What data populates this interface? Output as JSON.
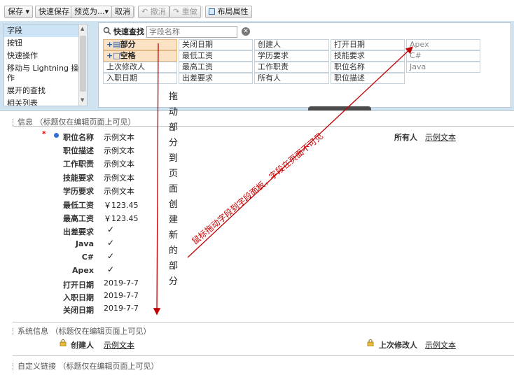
{
  "toolbar": {
    "save": "保存 ▾",
    "quick_save": "快速保存",
    "preview": "预览为...▾",
    "cancel": "取消",
    "undo": "撤消",
    "redo": "重做",
    "layout_props": "布局属性"
  },
  "categories": [
    "字段",
    "按钮",
    "快速操作",
    "移动与 Lightning 操作",
    "展开的查找",
    "相关列表"
  ],
  "quick_find": {
    "label": "快速查找",
    "placeholder": "字段名称"
  },
  "palette_fields": [
    [
      "部分",
      "关闭日期",
      "创建人",
      "打开日期",
      "Apex"
    ],
    [
      "空格",
      "最低工资",
      "学历要求",
      "技能要求",
      "C#"
    ],
    [
      "上次修改人",
      "最高工资",
      "工作职责",
      "职位名称",
      "Java"
    ],
    [
      "入职日期",
      "出差要求",
      "所有人",
      "职位描述",
      ""
    ]
  ],
  "annotations": {
    "vertical": "拖动部分到页面创建新的部分",
    "diagonal": "鼠标拖动字段到字段面板，字段在页面不可见"
  },
  "section_info": {
    "title": "信息 （标题仅在编辑页面上可见）",
    "fields": [
      {
        "label": "职位名称",
        "value": "示例文本",
        "type": "text"
      },
      {
        "label": "职位描述",
        "value": "示例文本",
        "type": "text"
      },
      {
        "label": "工作职责",
        "value": "示例文本",
        "type": "text"
      },
      {
        "label": "技能要求",
        "value": "示例文本",
        "type": "text"
      },
      {
        "label": "学历要求",
        "value": "示例文本",
        "type": "text"
      },
      {
        "label": "最低工资",
        "value": "￥123.45",
        "type": "text"
      },
      {
        "label": "最高工资",
        "value": "￥123.45",
        "type": "text"
      },
      {
        "label": "出差要求",
        "value": "✓",
        "type": "check"
      },
      {
        "label": "Java",
        "value": "✓",
        "type": "check"
      },
      {
        "label": "C#",
        "value": "✓",
        "type": "check"
      },
      {
        "label": "Apex",
        "value": "✓",
        "type": "check"
      },
      {
        "label": "打开日期",
        "value": "2019-7-7",
        "type": "text"
      },
      {
        "label": "入职日期",
        "value": "2019-7-7",
        "type": "text"
      },
      {
        "label": "关闭日期",
        "value": "2019-7-7",
        "type": "text"
      }
    ],
    "owner_label": "所有人",
    "owner_value": "示例文本"
  },
  "section_system": {
    "title": "系统信息 （标题仅在编辑页面上可见）",
    "created_by_label": "创建人",
    "created_by_value": "示例文本",
    "modified_by_label": "上次修改人",
    "modified_by_value": "示例文本"
  },
  "section_links": {
    "title": "自定义链接 （标题仅在编辑页面上可见）"
  },
  "colors": {
    "palette_bg": "#cfe3f0",
    "special_cell": "#fbe2c5",
    "arrow": "#c00000",
    "required": "#dd0000"
  }
}
